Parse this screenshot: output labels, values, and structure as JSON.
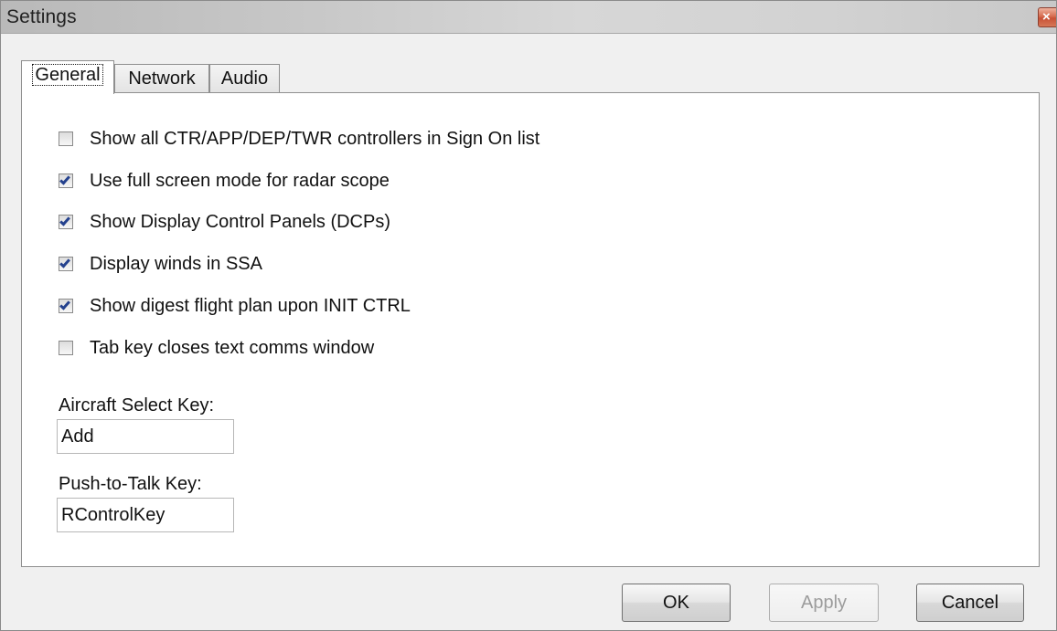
{
  "window": {
    "title": "Settings",
    "close_icon": "×"
  },
  "tabs": [
    {
      "label": "General",
      "selected": true
    },
    {
      "label": "Network",
      "selected": false
    },
    {
      "label": "Audio",
      "selected": false
    }
  ],
  "options": [
    {
      "label": "Show all CTR/APP/DEP/TWR controllers in Sign On list",
      "checked": false
    },
    {
      "label": "Use full screen mode for radar scope",
      "checked": true
    },
    {
      "label": "Show Display Control Panels (DCPs)",
      "checked": true
    },
    {
      "label": "Display winds in SSA",
      "checked": true
    },
    {
      "label": "Show digest flight plan upon INIT CTRL",
      "checked": true
    },
    {
      "label": "Tab key closes text comms window",
      "checked": false
    }
  ],
  "fields": {
    "aircraft_select": {
      "label": "Aircraft Select Key:",
      "value": "Add"
    },
    "push_to_talk": {
      "label": "Push-to-Talk Key:",
      "value": "RControlKey"
    }
  },
  "buttons": {
    "ok": "OK",
    "apply": "Apply",
    "cancel": "Cancel"
  },
  "colors": {
    "panel_background": "#ffffff",
    "dialog_background": "#f0f0f0",
    "checkmark": "#24418e",
    "close_button": "#c85136"
  }
}
